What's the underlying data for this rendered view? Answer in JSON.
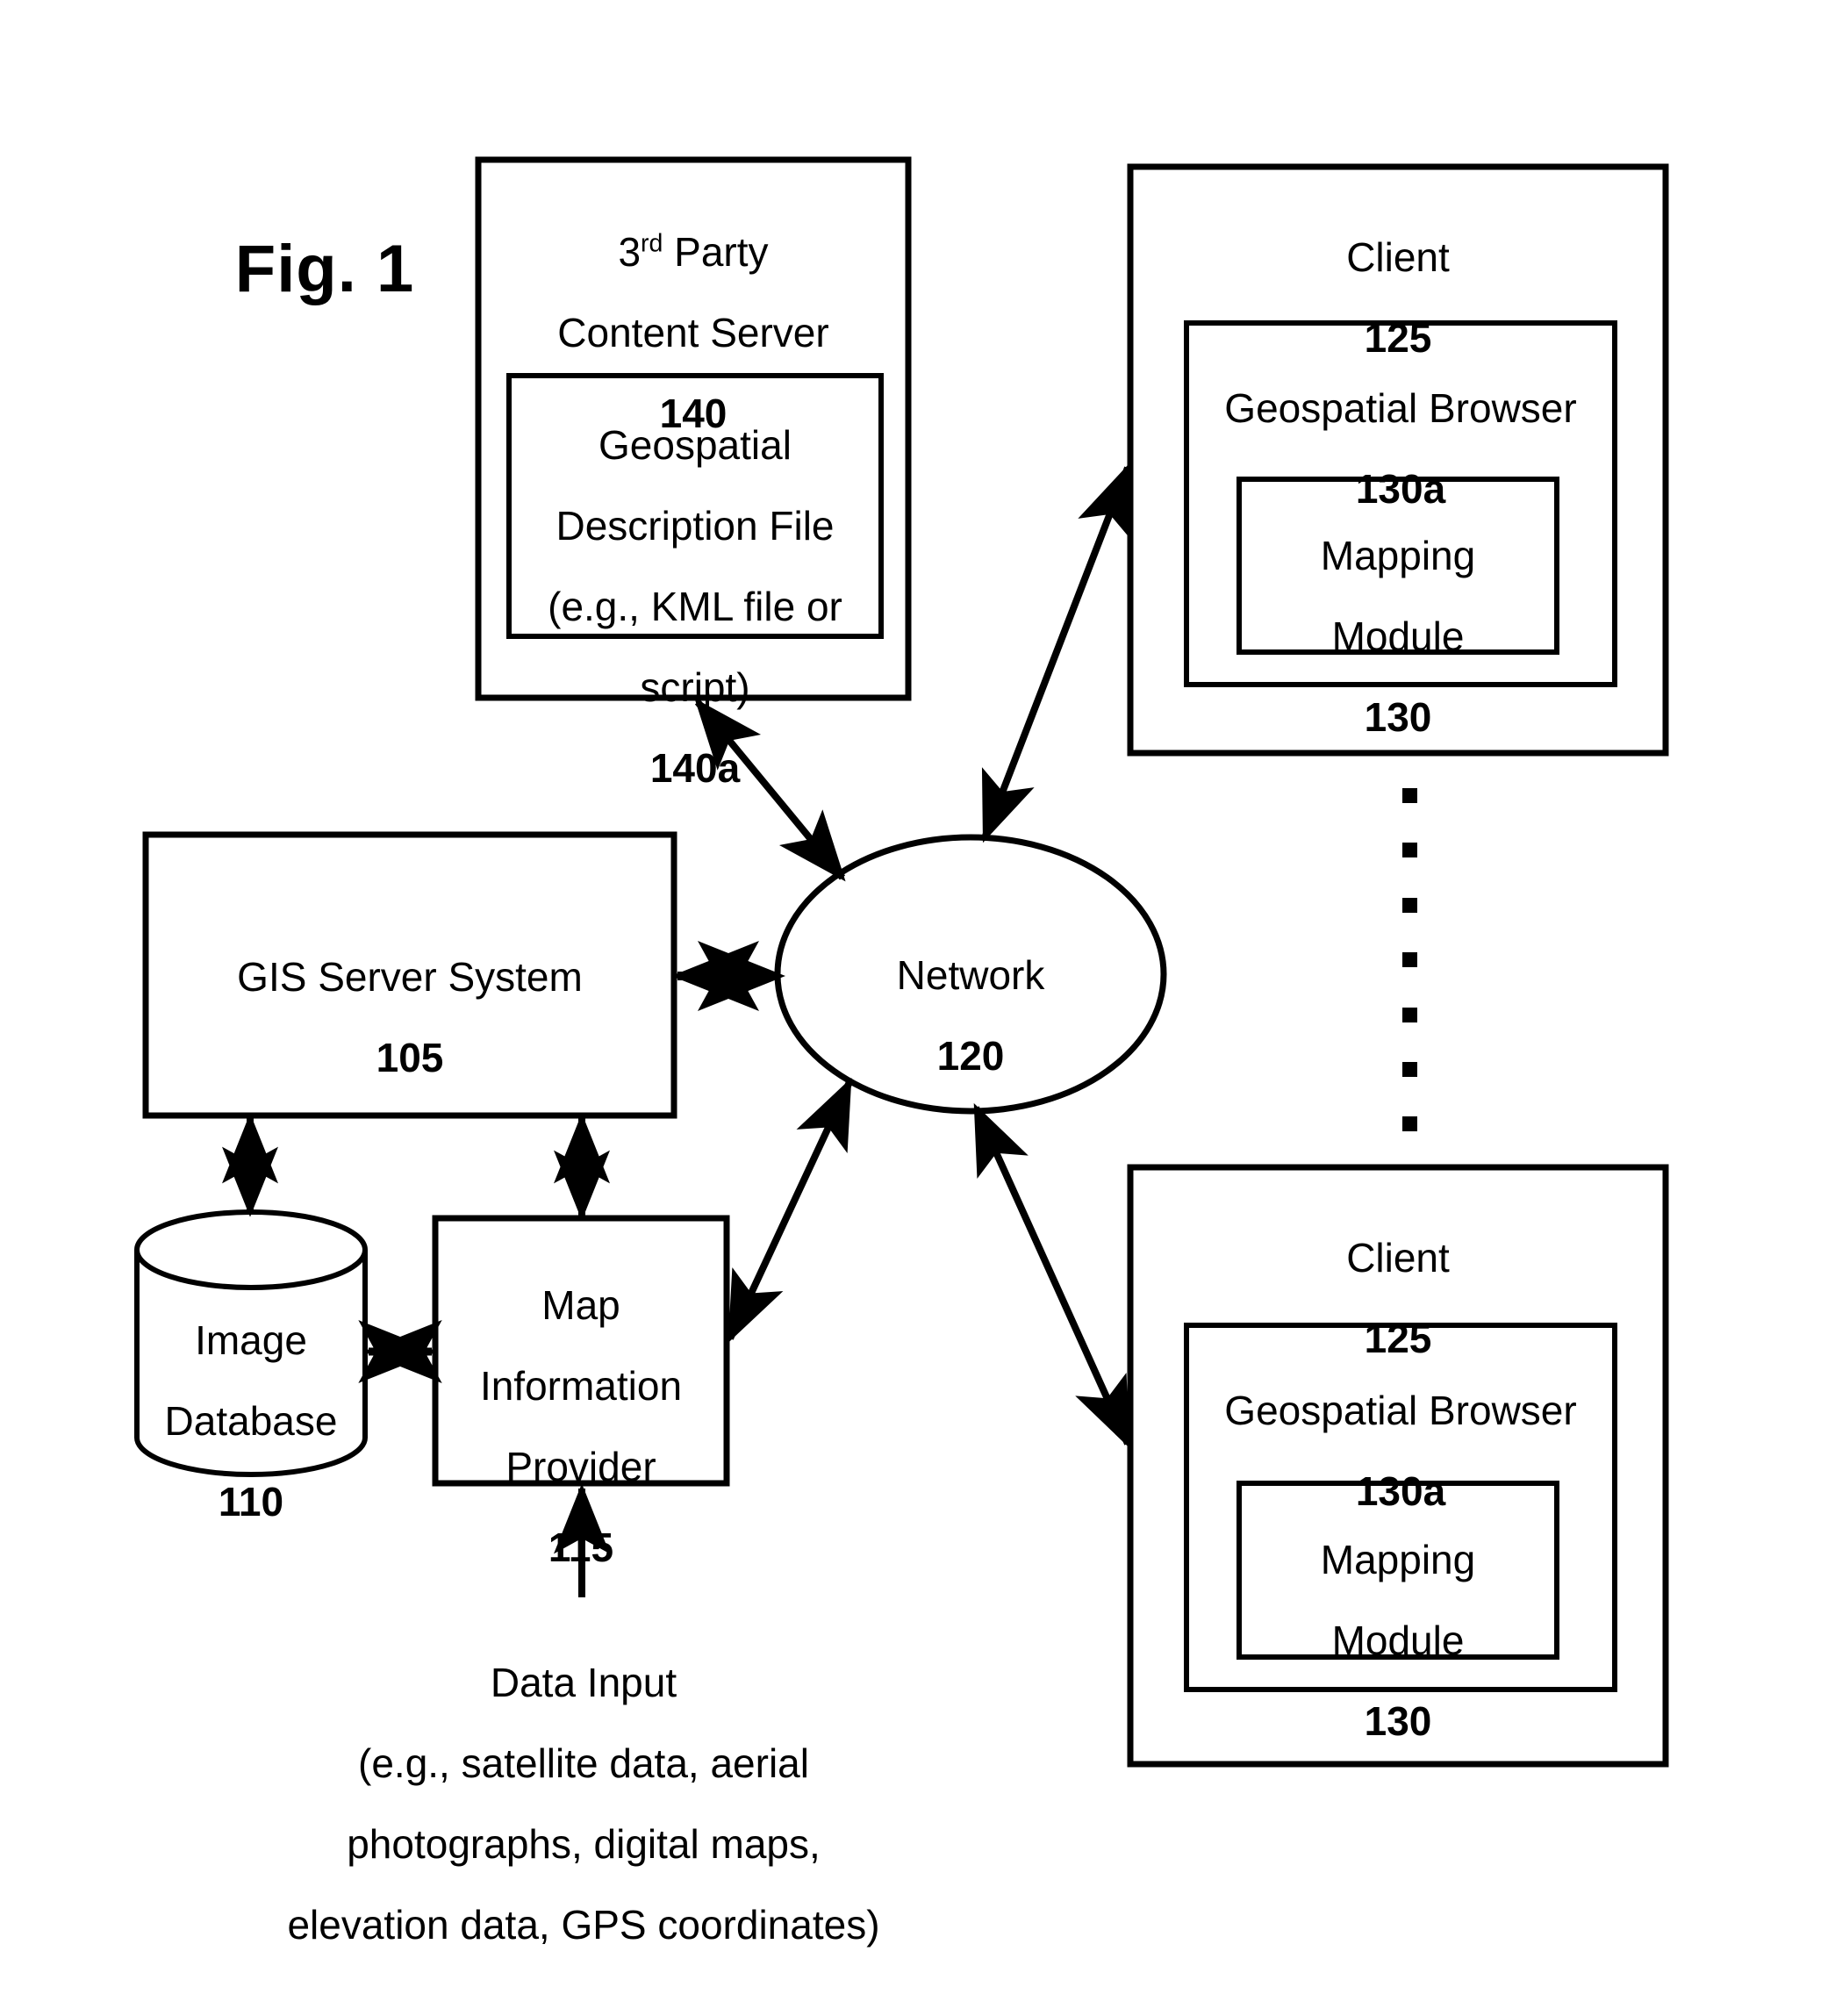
{
  "figure": {
    "label": "Fig. 1"
  },
  "nodes": {
    "third_party_content_server": {
      "title_line1_prefix": "3",
      "title_line1_sup": "rd",
      "title_line1_suffix": " Party",
      "title_line2": "Content Server",
      "ref": "140"
    },
    "geospatial_description_file": {
      "line1": "Geospatial",
      "line2": "Description File",
      "line3": "(e.g., KML file or",
      "line4": "script)",
      "ref": "140a"
    },
    "client_top": {
      "title": "Client",
      "ref": "125"
    },
    "geospatial_browser_top": {
      "title": "Geospatial Browser",
      "ref": "130a"
    },
    "mapping_module_top": {
      "line1": "Mapping",
      "line2": "Module",
      "ref": "130"
    },
    "client_bottom": {
      "title": "Client",
      "ref": "125"
    },
    "geospatial_browser_bottom": {
      "title": "Geospatial Browser",
      "ref": "130a"
    },
    "mapping_module_bottom": {
      "line1": "Mapping",
      "line2": "Module",
      "ref": "130"
    },
    "gis_server_system": {
      "title": "GIS Server System",
      "ref": "105"
    },
    "network": {
      "title": "Network",
      "ref": "120"
    },
    "image_database": {
      "line1": "Image",
      "line2": "Database",
      "ref": "110"
    },
    "map_information_provider": {
      "line1": "Map",
      "line2": "Information",
      "line3": "Provider",
      "ref": "115"
    },
    "data_input": {
      "line1": "Data Input",
      "line2": "(e.g., satellite data, aerial",
      "line3": "photographs, digital maps,",
      "line4": "elevation data, GPS coordinates)"
    }
  },
  "ellipsis": {
    "dot_count": 7
  },
  "colors": {
    "stroke": "#000000",
    "background": "#ffffff"
  }
}
